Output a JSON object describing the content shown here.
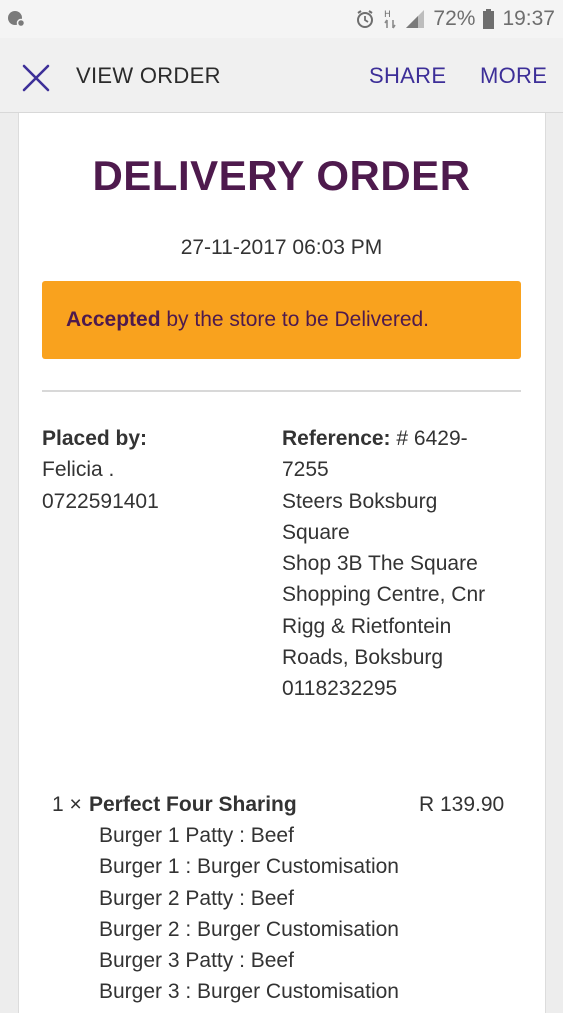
{
  "status_bar": {
    "battery": "72%",
    "time": "19:37",
    "icons": [
      "notification-icon",
      "alarm-icon",
      "network-h-icon",
      "signal-icon",
      "battery-icon"
    ]
  },
  "app_bar": {
    "title": "VIEW ORDER",
    "share_label": "SHARE",
    "more_label": "MORE",
    "accent_color": "#3d2f98"
  },
  "order": {
    "title": "DELIVERY ORDER",
    "date": "27-11-2017 06:03 PM",
    "status": {
      "bold": "Accepted",
      "rest": " by the store to be Delivered.",
      "color": "#f9a21e"
    },
    "placed_by": {
      "label": "Placed by:",
      "name": "Felicia .",
      "phone": "0722591401"
    },
    "reference": {
      "label": "Reference:",
      "number_line1": " # 6429-",
      "number_line2": "7255",
      "store_line1": "Steers Boksburg",
      "store_line2": "Square",
      "address_line1": "Shop 3B The Square",
      "address_line2": "Shopping Centre, Cnr",
      "address_line3": "Rigg & Rietfontein",
      "address_line4": "Roads, Boksburg",
      "phone": "0118232295"
    },
    "items": [
      {
        "qty": "1 ×",
        "name": "Perfect Four Sharing",
        "price": "R 139.90",
        "customisations": [
          "Burger 1 Patty : Beef",
          "Burger 1 : Burger Customisation",
          "Burger 2 Patty : Beef",
          "Burger 2 : Burger Customisation",
          "Burger 3 Patty : Beef",
          "Burger 3 : Burger Customisation"
        ]
      }
    ]
  }
}
